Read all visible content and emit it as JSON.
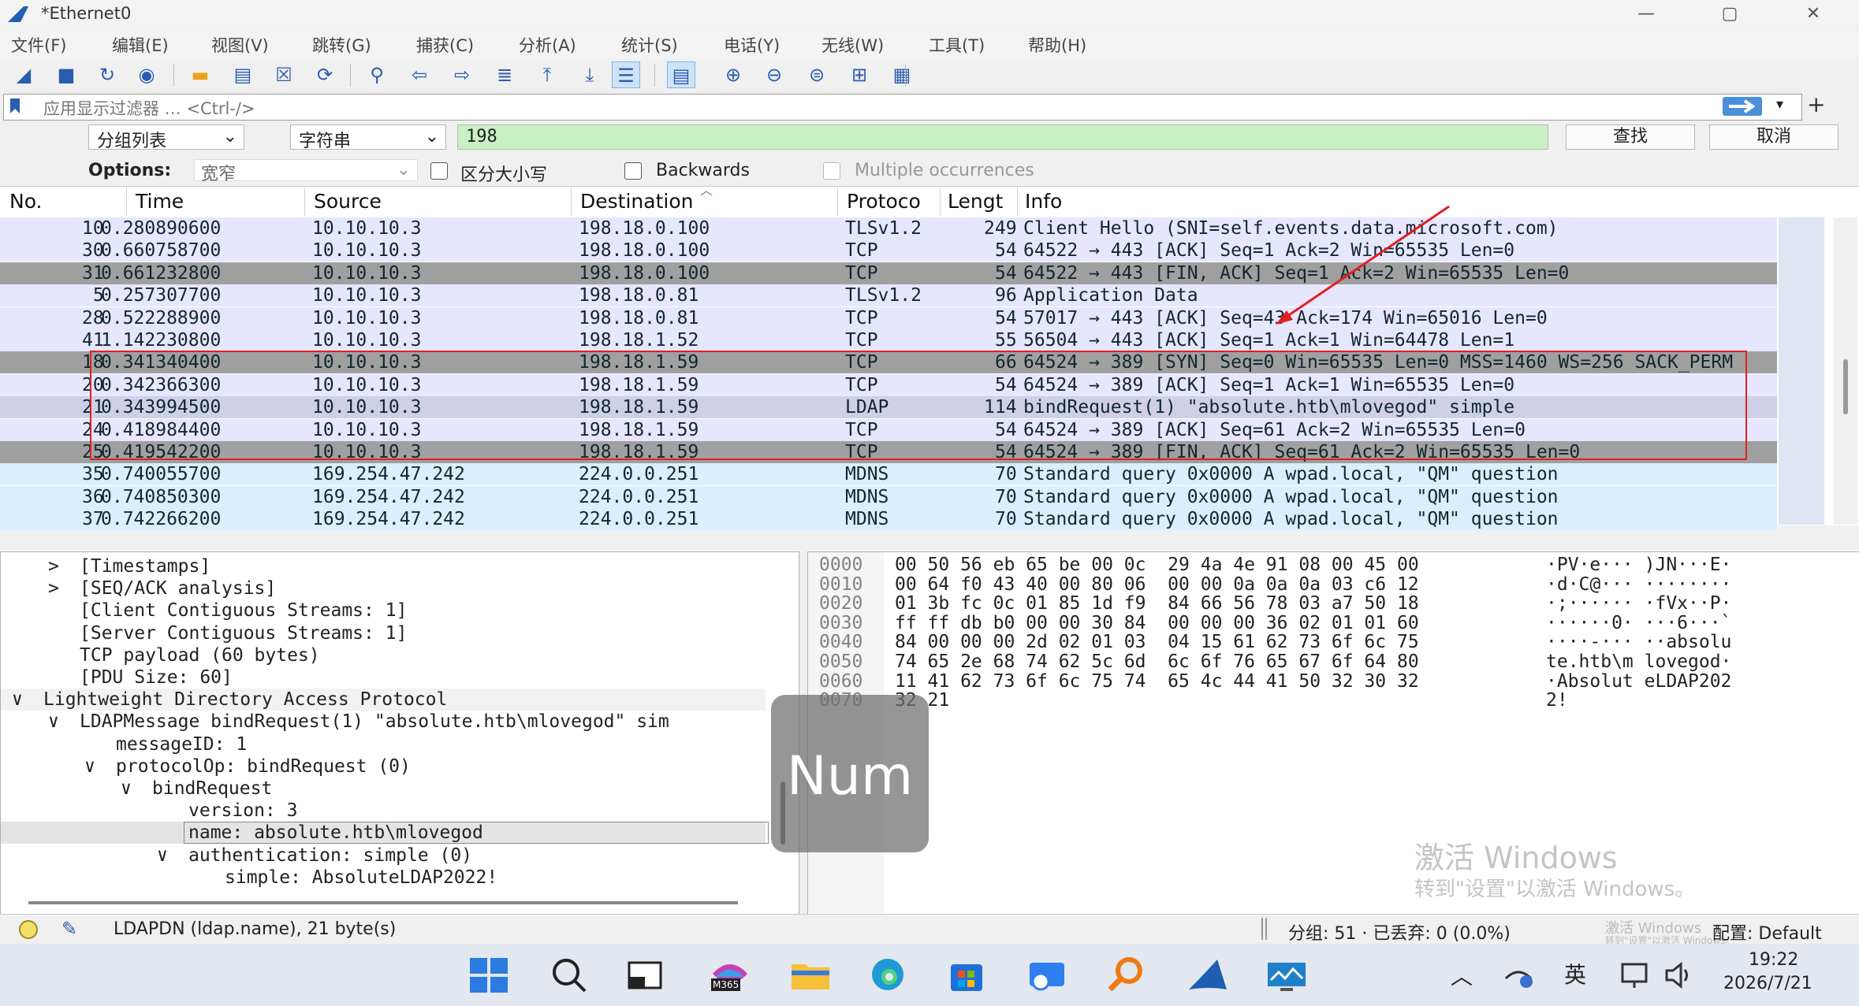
{
  "window": {
    "title": "*Ethernet0",
    "minimize": "—",
    "maximize": "▢",
    "close": "✕"
  },
  "menu": [
    "文件(F)",
    "编辑(E)",
    "视图(V)",
    "跳转(G)",
    "捕获(C)",
    "分析(A)",
    "统计(S)",
    "电话(Y)",
    "无线(W)",
    "工具(T)",
    "帮助(H)"
  ],
  "toolbar_icons": [
    "shark-fin-start",
    "stop",
    "restart",
    "capture-options",
    "open-file",
    "open-recent",
    "close-file",
    "reload",
    "find-packet",
    "go-back",
    "go-forward",
    "go-to-packet",
    "go-first",
    "go-last",
    "autoscroll",
    "colorize",
    "zoom-in",
    "zoom-out",
    "zoom-normal",
    "resize-columns",
    "layout"
  ],
  "display_filter": {
    "placeholder": "应用显示过滤器 … <Ctrl-/>",
    "plus": "+"
  },
  "find": {
    "search_in": "分组列表",
    "search_type": "字符串",
    "value": "198",
    "find_button": "查找",
    "cancel_button": "取消"
  },
  "options": {
    "label": "Options:",
    "charset": "宽窄",
    "case_sensitive": "区分大小写",
    "backwards": "Backwards",
    "multiple": "Multiple occurrences"
  },
  "columns": [
    "No.",
    "Time",
    "Source",
    "Destination",
    "Protoco",
    "Lengt",
    "Info"
  ],
  "packets": [
    {
      "no": "10",
      "time": "0.280890600",
      "src": "10.10.10.3",
      "dst": "198.18.0.100",
      "proto": "TLSv1.2",
      "len": "249",
      "info": "Client Hello (SNI=self.events.data.microsoft.com)",
      "bg": "#e7e6ff",
      "fg": "#12272e"
    },
    {
      "no": "30",
      "time": "0.660758700",
      "src": "10.10.10.3",
      "dst": "198.18.0.100",
      "proto": "TCP",
      "len": "54",
      "info": "64522 → 443 [ACK] Seq=1 Ack=2 Win=65535 Len=0",
      "bg": "#e7e6ff",
      "fg": "#12272e"
    },
    {
      "no": "31",
      "time": "0.661232800",
      "src": "10.10.10.3",
      "dst": "198.18.0.100",
      "proto": "TCP",
      "len": "54",
      "info": "64522 → 443 [FIN, ACK] Seq=1 Ack=2 Win=65535 Len=0",
      "bg": "#a0a0a0",
      "fg": "#12272e"
    },
    {
      "no": "5",
      "time": "0.257307700",
      "src": "10.10.10.3",
      "dst": "198.18.0.81",
      "proto": "TLSv1.2",
      "len": "96",
      "info": "Application Data",
      "bg": "#e7e6ff",
      "fg": "#12272e"
    },
    {
      "no": "28",
      "time": "0.522288900",
      "src": "10.10.10.3",
      "dst": "198.18.0.81",
      "proto": "TCP",
      "len": "54",
      "info": "57017 → 443 [ACK] Seq=43 Ack=174 Win=65016 Len=0",
      "bg": "#e7e6ff",
      "fg": "#12272e"
    },
    {
      "no": "41",
      "time": "1.142230800",
      "src": "10.10.10.3",
      "dst": "198.18.1.52",
      "proto": "TCP",
      "len": "55",
      "info": "56504 → 443 [ACK] Seq=1 Ack=1 Win=64478 Len=1",
      "bg": "#e7e6ff",
      "fg": "#12272e"
    },
    {
      "no": "18",
      "time": "0.341340400",
      "src": "10.10.10.3",
      "dst": "198.18.1.59",
      "proto": "TCP",
      "len": "66",
      "info": "64524 → 389 [SYN] Seq=0 Win=65535 Len=0 MSS=1460 WS=256 SACK_PERM",
      "bg": "#a0a0a0",
      "fg": "#12272e"
    },
    {
      "no": "20",
      "time": "0.342366300",
      "src": "10.10.10.3",
      "dst": "198.18.1.59",
      "proto": "TCP",
      "len": "54",
      "info": "64524 → 389 [ACK] Seq=1 Ack=1 Win=65535 Len=0",
      "bg": "#e7e6ff",
      "fg": "#12272e"
    },
    {
      "no": "21",
      "time": "0.343994500",
      "src": "10.10.10.3",
      "dst": "198.18.1.59",
      "proto": "LDAP",
      "len": "114",
      "info": "bindRequest(1) \"absolute.htb\\mlovegod\" simple",
      "bg": "#cfcfe8",
      "fg": "#12272e"
    },
    {
      "no": "24",
      "time": "0.418984400",
      "src": "10.10.10.3",
      "dst": "198.18.1.59",
      "proto": "TCP",
      "len": "54",
      "info": "64524 → 389 [ACK] Seq=61 Ack=2 Win=65535 Len=0",
      "bg": "#e7e6ff",
      "fg": "#12272e"
    },
    {
      "no": "25",
      "time": "0.419542200",
      "src": "10.10.10.3",
      "dst": "198.18.1.59",
      "proto": "TCP",
      "len": "54",
      "info": "64524 → 389 [FIN, ACK] Seq=61 Ack=2 Win=65535 Len=0",
      "bg": "#a0a0a0",
      "fg": "#12272e"
    },
    {
      "no": "35",
      "time": "0.740055700",
      "src": "169.254.47.242",
      "dst": "224.0.0.251",
      "proto": "MDNS",
      "len": "70",
      "info": "Standard query 0x0000 A wpad.local, \"QM\" question",
      "bg": "#daeeff",
      "fg": "#12272e"
    },
    {
      "no": "36",
      "time": "0.740850300",
      "src": "169.254.47.242",
      "dst": "224.0.0.251",
      "proto": "MDNS",
      "len": "70",
      "info": "Standard query 0x0000 A wpad.local, \"QM\" question",
      "bg": "#daeeff",
      "fg": "#12272e"
    },
    {
      "no": "37",
      "time": "0.742266200",
      "src": "169.254.47.242",
      "dst": "224.0.0.251",
      "proto": "MDNS",
      "len": "70",
      "info": "Standard query 0x0000 A wpad.local, \"QM\" question",
      "bg": "#daeeff",
      "fg": "#12272e"
    }
  ],
  "details": [
    {
      "arrow": ">",
      "text": "[Timestamps]",
      "indent": 0
    },
    {
      "arrow": ">",
      "text": "[SEQ/ACK analysis]",
      "indent": 0
    },
    {
      "arrow": "",
      "text": "[Client Contiguous Streams: 1]",
      "indent": 0
    },
    {
      "arrow": "",
      "text": "[Server Contiguous Streams: 1]",
      "indent": 0
    },
    {
      "arrow": "",
      "text": "TCP payload (60 bytes)",
      "indent": 0
    },
    {
      "arrow": "",
      "text": "[PDU Size: 60]",
      "indent": 0
    },
    {
      "arrow": "∨",
      "text": "Lightweight Directory Access Protocol",
      "indent": -1
    },
    {
      "arrow": "∨",
      "text": "LDAPMessage bindRequest(1) \"absolute.htb\\mlovegod\" sim",
      "indent": 0
    },
    {
      "arrow": "",
      "text": "messageID: 1",
      "indent": 1
    },
    {
      "arrow": "∨",
      "text": "protocolOp: bindRequest (0)",
      "indent": 1
    },
    {
      "arrow": "∨",
      "text": "bindRequest",
      "indent": 2
    },
    {
      "arrow": "",
      "text": "version: 3",
      "indent": 3
    },
    {
      "arrow": "",
      "text": "name: absolute.htb\\mlovegod",
      "indent": 3
    },
    {
      "arrow": "∨",
      "text": "authentication: simple (0)",
      "indent": 3
    },
    {
      "arrow": "",
      "text": "simple: AbsoluteLDAP2022!",
      "indent": 4
    }
  ],
  "hex": [
    {
      "off": "0000",
      "bytes": "00 50 56 eb 65 be 00 0c  29 4a 4e 91 08 00 45 00",
      "ascii": "·PV·e··· )JN···E·"
    },
    {
      "off": "0010",
      "bytes": "00 64 f0 43 40 00 80 06  00 00 0a 0a 0a 03 c6 12",
      "ascii": "·d·C@··· ········"
    },
    {
      "off": "0020",
      "bytes": "01 3b fc 0c 01 85 1d f9  84 66 56 78 03 a7 50 18",
      "ascii": "·;······ ·fVx··P·"
    },
    {
      "off": "0030",
      "bytes": "ff ff db b0 00 00 30 84  00 00 00 36 02 01 01 60",
      "ascii": "······0· ···6···`"
    },
    {
      "off": "0040",
      "bytes": "84 00 00 00 2d 02 01 03  04 15 61 62 73 6f 6c 75",
      "ascii": "····-··· ··absolu"
    },
    {
      "off": "0050",
      "bytes": "74 65 2e 68 74 62 5c 6d  6c 6f 76 65 67 6f 64 80",
      "ascii": "te.htb\\m lovegod·"
    },
    {
      "off": "0060",
      "bytes": "11 41 62 73 6f 6c 75 74  65 4c 44 41 50 32 30 32",
      "ascii": "·Absolut eLDAP202"
    },
    {
      "off": "0070",
      "bytes": "32 21",
      "ascii": "2!"
    }
  ],
  "overlay": {
    "num": "Num"
  },
  "watermark": {
    "line1": "激活 Windows",
    "line2": "转到\"设置\"以激活 Windows。"
  },
  "status": {
    "field": "LDAPDN (ldap.name), 21 byte(s)",
    "stats": "分组: 51 · 已丢弃: 0 (0.0%)",
    "profile": "配置: Default",
    "small_watermark": "激活 Windows",
    "small_watermark2": "转到\"设置\"以激活 Windows。"
  },
  "taskbar": {
    "icons": [
      "start-icon",
      "search-icon",
      "terminal-icon",
      "m365-icon",
      "file-explorer-icon",
      "edge-icon",
      "store-icon",
      "security-icon",
      "search-tool-icon",
      "wireshark-icon",
      "monitor-icon"
    ],
    "m365_label": "M365",
    "chevron": "︿",
    "ime": "英",
    "time": "19:22",
    "date": "2026/7/21"
  },
  "colors": {
    "highlight_box": "#e02020",
    "find_bg": "#c9f0c4",
    "accent": "#2a5db0"
  }
}
